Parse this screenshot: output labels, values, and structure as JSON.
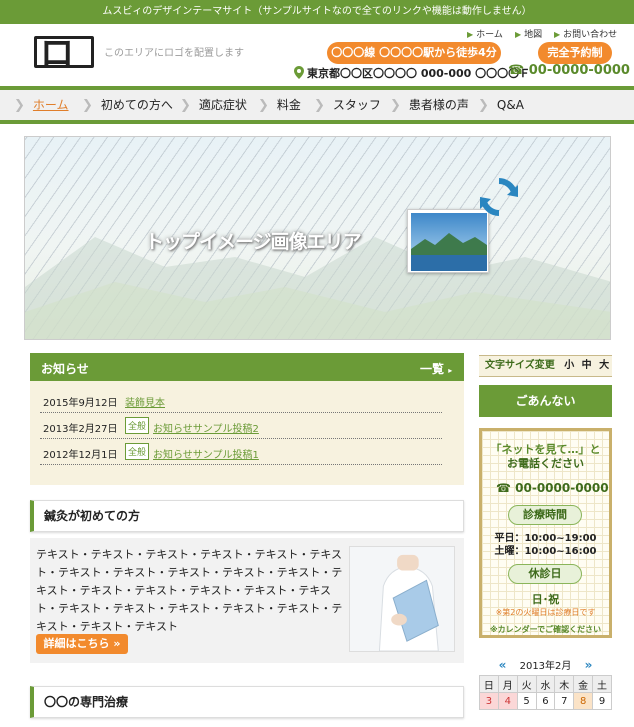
{
  "topbar": {
    "text": "ムスビィのデザインテーマサイト（サンプルサイトなので全てのリンクや機能は動作しません）"
  },
  "header": {
    "logo": "ロゴ",
    "logo_note": "このエリアにロゴを配置します",
    "links": {
      "home": "ホーム",
      "map": "地図",
      "contact": "お問い合わせ"
    },
    "access": "〇〇〇線 〇〇〇〇駅から徒歩4分",
    "reserve": "完全予約制",
    "address": "東京都〇〇区〇〇〇〇 000-000 〇〇〇〇Ｆ",
    "tel": "00-0000-0000"
  },
  "nav": [
    {
      "label": "ホーム",
      "active": true
    },
    {
      "label": "初めての方へ"
    },
    {
      "label": "適応症状"
    },
    {
      "label": "料金"
    },
    {
      "label": "スタッフ"
    },
    {
      "label": "患者様の声"
    },
    {
      "label": "Q&A"
    }
  ],
  "hero": {
    "text": "トップイメージ画像エリア"
  },
  "news": {
    "title": "お知らせ",
    "more": "一覧",
    "items": [
      {
        "date": "2015年9月12日",
        "tag": "",
        "title": "装飾見本"
      },
      {
        "date": "2013年2月27日",
        "tag": "全般",
        "title": "お知らせサンプル投稿2"
      },
      {
        "date": "2012年12月1日",
        "tag": "全般",
        "title": "お知らせサンプル投稿1"
      }
    ]
  },
  "first": {
    "title": "鍼灸が初めての方",
    "body": "テキスト・テキスト・テキスト・テキスト・テキスト・テキスト・テキスト・テキスト・テキスト・テキスト・テキスト・テキスト・テキスト・テキスト・テキスト・テキスト・テキスト・テキスト・テキスト・テキスト・テキスト・テキスト・テキスト・テキスト・テキスト",
    "button": "詳細はこちら »"
  },
  "section2": {
    "title": "〇〇の専門治療"
  },
  "sidebar": {
    "fontsize_label": "文字サイズ変更",
    "sizes": [
      "小",
      "中",
      "大"
    ],
    "guide": "ごあんない",
    "contact_lead_1": "「ネットを見て…」と",
    "contact_lead_2": "お電話ください",
    "tel": "00-0000-0000",
    "hours_title": "診療時間",
    "hours_weekday": "平日：10:00~19:00",
    "hours_sat": "土曜：10:00~16:00",
    "closed_title": "休診日",
    "closed_days": "日･祝",
    "note1": "※第2の火曜日は診療日です",
    "note2": "※カレンダーでご確認ください"
  },
  "calendar": {
    "title": "2013年2月",
    "weekdays": [
      "日",
      "月",
      "火",
      "水",
      "木",
      "金",
      "土"
    ],
    "row1": [
      "3",
      "4",
      "5",
      "6",
      "7",
      "8",
      "9"
    ]
  },
  "colors": {
    "green": "#6b9b37",
    "orange": "#f28a2d",
    "cream": "#f7f2df"
  }
}
